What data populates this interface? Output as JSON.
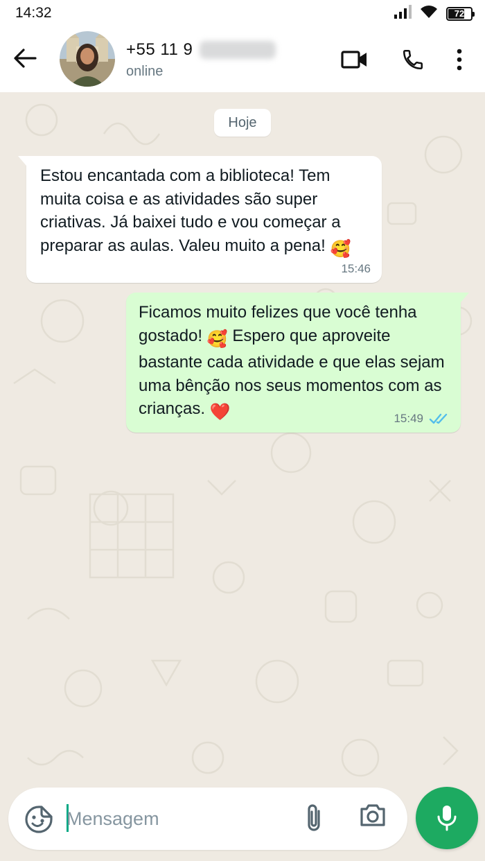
{
  "status_bar": {
    "time": "14:32",
    "battery": "72",
    "icons": [
      "signal-icon",
      "wifi-icon",
      "battery-icon"
    ]
  },
  "header": {
    "contact_name": "+55 11 9",
    "contact_status": "online",
    "icons": [
      "back-arrow-icon",
      "video-call-icon",
      "phone-call-icon",
      "more-vert-icon"
    ]
  },
  "chat": {
    "date_divider": "Hoje",
    "messages": [
      {
        "direction": "incoming",
        "text": "Estou encantada com a biblioteca! Tem muita coisa e as atividades são super criativas. Já baixei tudo e vou começar a preparar as aulas. Valeu muito a pena!",
        "emoji": "🥰",
        "time": "15:46"
      },
      {
        "direction": "outgoing",
        "text_part1": "Ficamos muito felizes que você tenha gostado!",
        "emoji1": "🥰",
        "text_part2": "Espero que aproveite bastante cada atividade e que elas sejam uma bênção nos seus momentos com as crianças.",
        "emoji2": "❤️",
        "time": "15:49",
        "status": "read"
      }
    ]
  },
  "composer": {
    "placeholder": "Mensagem",
    "value": "",
    "icons": [
      "sticker-icon",
      "attach-icon",
      "camera-icon",
      "mic-icon"
    ]
  },
  "colors": {
    "incoming_bubble": "#ffffff",
    "outgoing_bubble": "#d9fdd3",
    "wallpaper": "#efeae2",
    "accent": "#1daa61",
    "read_ticks": "#53bdeb"
  }
}
